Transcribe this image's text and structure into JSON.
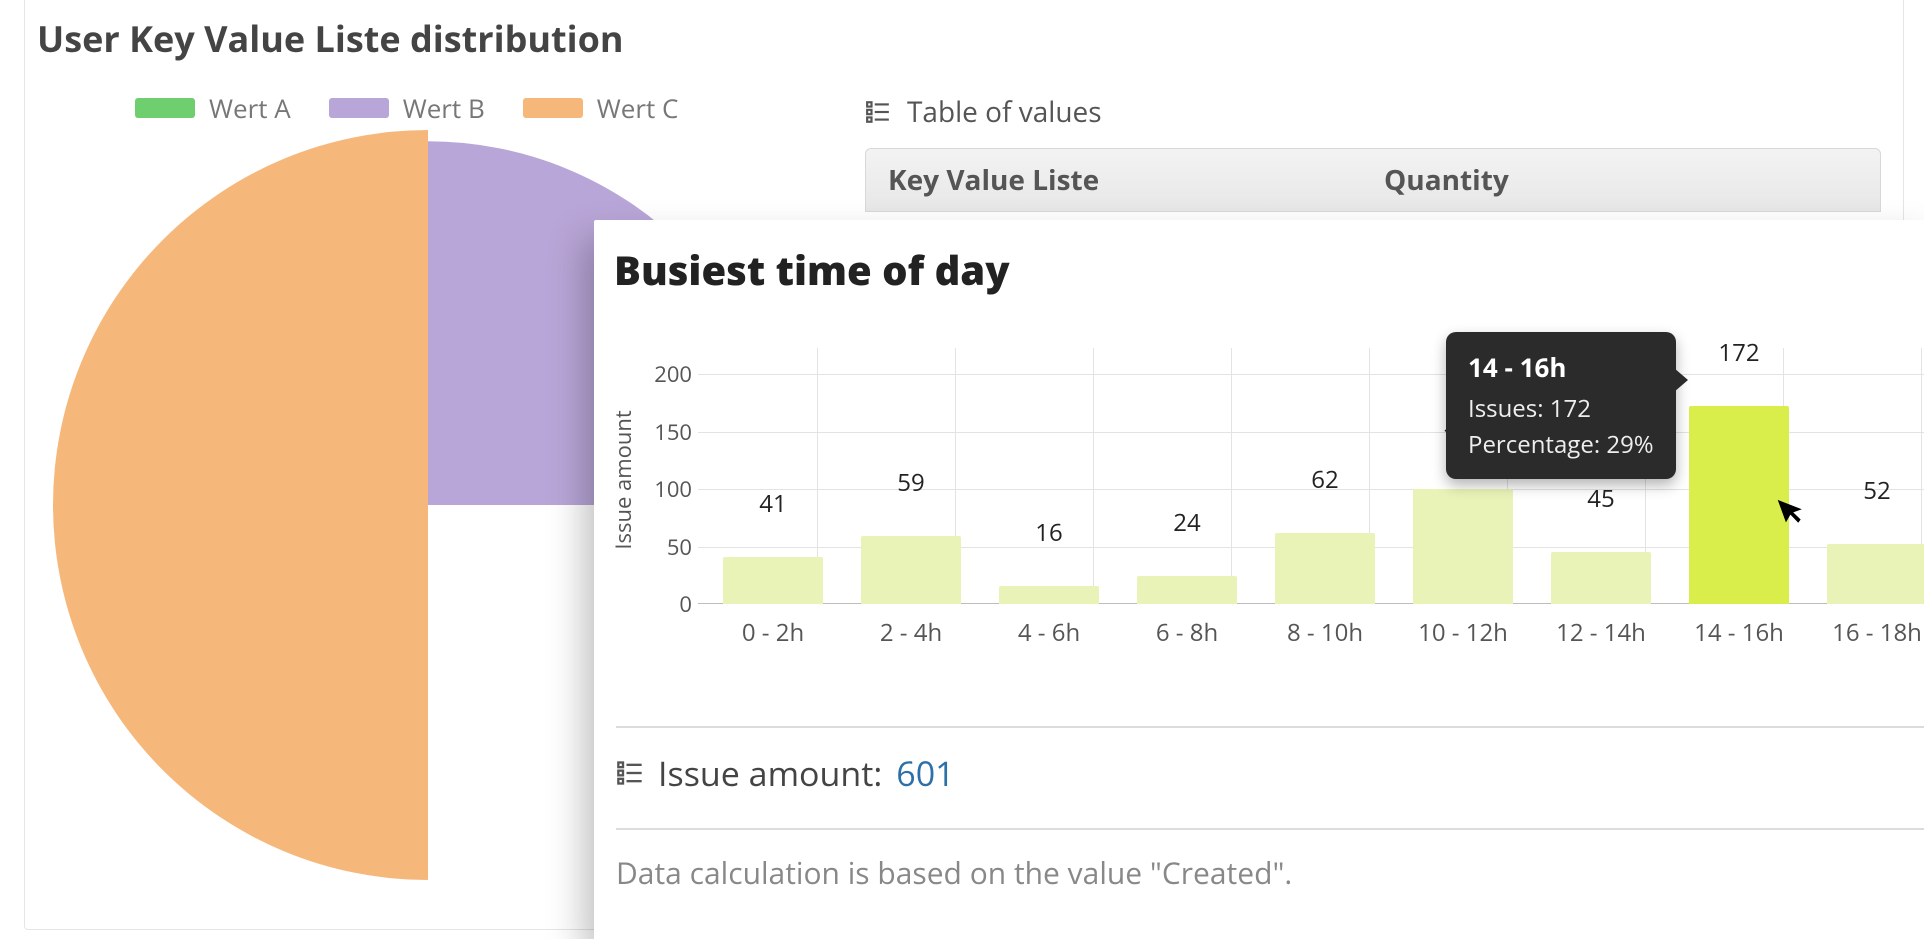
{
  "pie_panel": {
    "title": "User Key Value Liste distribution",
    "legend": [
      {
        "label": "Wert A",
        "color": "#6fcf6f"
      },
      {
        "label": "Wert B",
        "color": "#b9a6d8"
      },
      {
        "label": "Wert C",
        "color": "#f6b77a"
      }
    ],
    "table_of_values_label": "Table of values",
    "table": {
      "col1": "Key Value Liste",
      "col2": "Quantity"
    }
  },
  "bar_panel": {
    "title": "Busiest time of day",
    "ylabel": "Issue amount",
    "total_label": "Issue amount:",
    "total_value": "601",
    "footer": "Data calculation is based on the value \"Created\"."
  },
  "tooltip": {
    "title": "14 - 16h",
    "line1": "Issues: 172",
    "line2": "Percentage: 29%"
  },
  "chart_data": [
    {
      "type": "pie",
      "title": "User Key Value Liste distribution",
      "legend_position": "top",
      "series": [
        {
          "name": "Wert A",
          "value": 0,
          "color": "#6fcf6f"
        },
        {
          "name": "Wert B",
          "value": 25,
          "color": "#b9a6d8"
        },
        {
          "name": "Wert C",
          "value": 50,
          "color": "#f6b77a"
        }
      ],
      "note": "Only left half of pie visible (Wert C ~left half, Wert B ~upper-right quarter); Wert A slice not visible."
    },
    {
      "type": "bar",
      "title": "Busiest time of day",
      "xlabel": "",
      "ylabel": "Issue amount",
      "ylim": [
        0,
        200
      ],
      "yticks": [
        0,
        50,
        100,
        150,
        200
      ],
      "grid": true,
      "categories": [
        "0 - 2h",
        "2 - 4h",
        "4 - 6h",
        "6 - 8h",
        "8 - 10h",
        "10 - 12h",
        "12 - 14h",
        "14 - 16h",
        "16 - 18h"
      ],
      "values": [
        41,
        59,
        16,
        24,
        62,
        100,
        45,
        172,
        52
      ],
      "highlight_index": 7,
      "tooltip": {
        "category": "14 - 16h",
        "issues": 172,
        "percentage": "29%"
      },
      "total": 601,
      "cutoff_right": true
    }
  ]
}
